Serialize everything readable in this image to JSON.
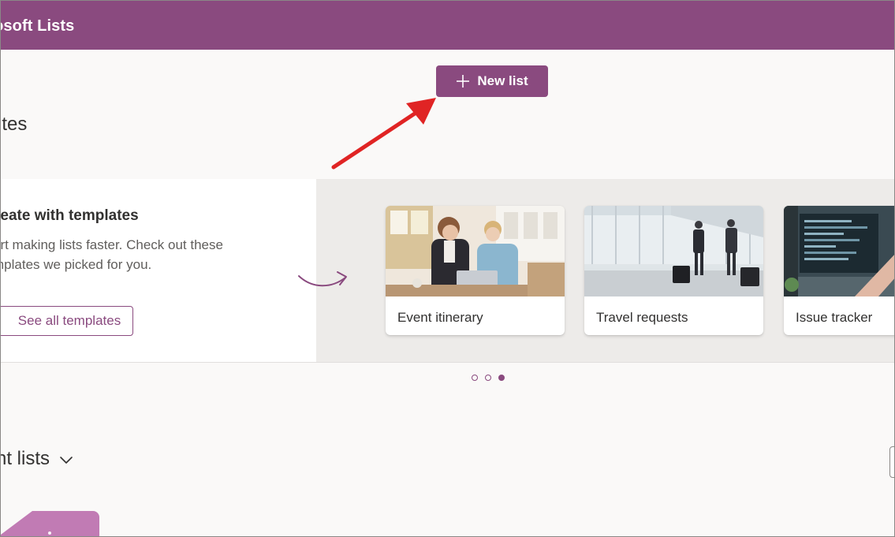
{
  "app": {
    "title": "crosoft Lists"
  },
  "toolbar": {
    "new_list_label": "New list"
  },
  "sections": {
    "favorites_title": "ites",
    "recent_title": "nt lists"
  },
  "templates": {
    "intro_title": "reate with templates",
    "intro_desc_line1": "art making lists faster. Check out these",
    "intro_desc_line2": "mplates we picked for you.",
    "see_all_label": "See all templates",
    "cards": [
      {
        "label": "Event itinerary"
      },
      {
        "label": "Travel requests"
      },
      {
        "label": "Issue tracker"
      }
    ]
  },
  "pager": {
    "active_index": 2,
    "count": 3
  },
  "colors": {
    "brand": "#8a4a7f",
    "annotation_arrow": "#e02424",
    "background": "#faf9f8"
  }
}
